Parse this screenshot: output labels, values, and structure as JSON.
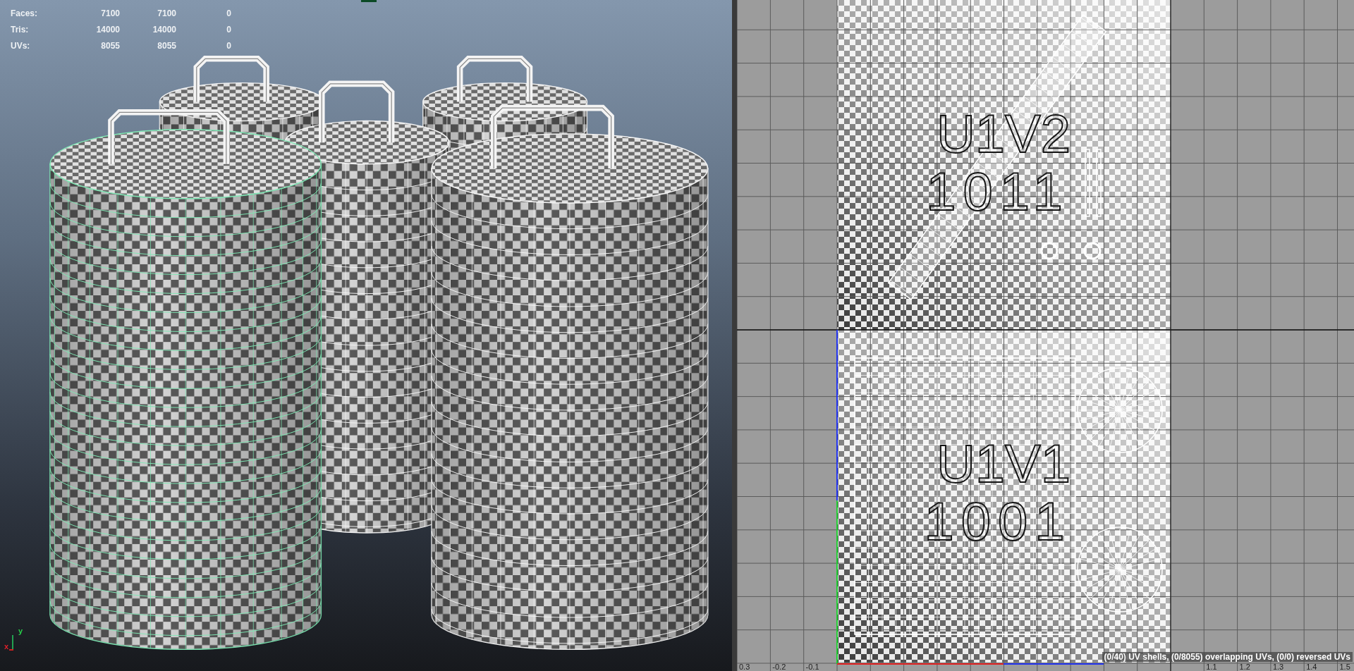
{
  "viewport": {
    "hud": [
      {
        "label": "Faces:",
        "values": [
          "7100",
          "7100",
          "0"
        ]
      },
      {
        "label": "Tris:",
        "values": [
          "14000",
          "14000",
          "0"
        ]
      },
      {
        "label": "UVs:",
        "values": [
          "8055",
          "8055",
          "0"
        ]
      }
    ],
    "objects": [
      {
        "selected": false
      },
      {
        "selected": false
      },
      {
        "selected": false
      },
      {
        "selected": true
      },
      {
        "selected": false
      }
    ],
    "axis_gizmo": {
      "x": "x",
      "y": "y"
    }
  },
  "uv_editor": {
    "tiles": [
      {
        "name": "U1V2",
        "udim": "1011"
      },
      {
        "name": "U1V1",
        "udim": "1001"
      }
    ],
    "u_axis": {
      "left_labels": [
        "0.3",
        "-0.2",
        "-0.1"
      ],
      "right_labels": [
        "1.1",
        "1.2",
        "1.3",
        "1.4",
        "1.5"
      ]
    },
    "status": "(0/40) UV shells, (0/8055) overlapping UVs, (0/0) reversed UVs"
  }
}
